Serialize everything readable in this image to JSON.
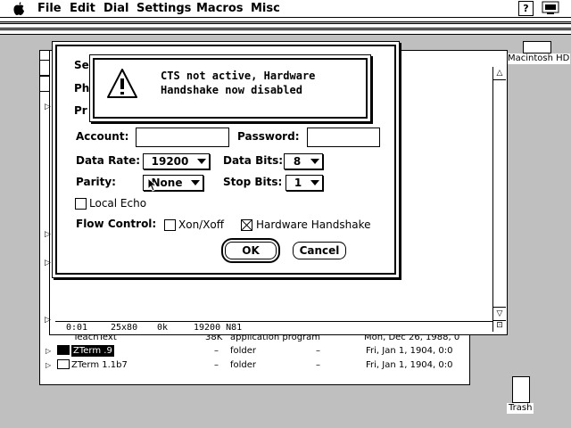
{
  "menubar": {
    "items": [
      "File",
      "Edit",
      "Dial",
      "Settings",
      "Macros",
      "Misc"
    ],
    "help_glyph": "?"
  },
  "desktop": {
    "disk_label": "Macintosh HD",
    "trash_label": "Trash"
  },
  "finder_window": {
    "rows": [
      {
        "name": "TeachText",
        "size": "38K",
        "kind": "application program",
        "dash": "",
        "date": "Mon, Dec 26, 1988, 0"
      },
      {
        "name": "ZTerm .9",
        "size": "–",
        "kind": "folder",
        "dash": "–",
        "date": "Fri, Jan 1, 1904, 0:0"
      },
      {
        "name": "ZTerm 1.1b7",
        "size": "–",
        "kind": "folder",
        "dash": "–",
        "date": "Fri, Jan 1, 1904, 0:0"
      }
    ]
  },
  "terminal_window": {
    "status": {
      "time": "0:01",
      "size": "25x80",
      "buffer": "0k",
      "mode": "19200 N81"
    }
  },
  "settings_dialog": {
    "hidden_labels": [
      "Se",
      "Ph",
      "Pr"
    ],
    "account_label": "Account:",
    "account_value": "",
    "password_label": "Password:",
    "password_value": "",
    "data_rate_label": "Data Rate:",
    "data_rate_value": "19200",
    "data_bits_label": "Data Bits:",
    "data_bits_value": "8",
    "parity_label": "Parity:",
    "parity_value": "None",
    "stop_bits_label": "Stop Bits:",
    "stop_bits_value": "1",
    "local_echo_label": "Local Echo",
    "local_echo_checked": false,
    "flow_control_label": "Flow Control:",
    "xon_xoff_label": "Xon/Xoff",
    "xon_xoff_checked": false,
    "hardware_handshake_label": "Hardware Handshake",
    "hardware_handshake_checked": true,
    "ok_label": "OK",
    "cancel_label": "Cancel"
  },
  "alert": {
    "line1": "CTS not active, Hardware",
    "line2": "Handshake now disabled"
  }
}
